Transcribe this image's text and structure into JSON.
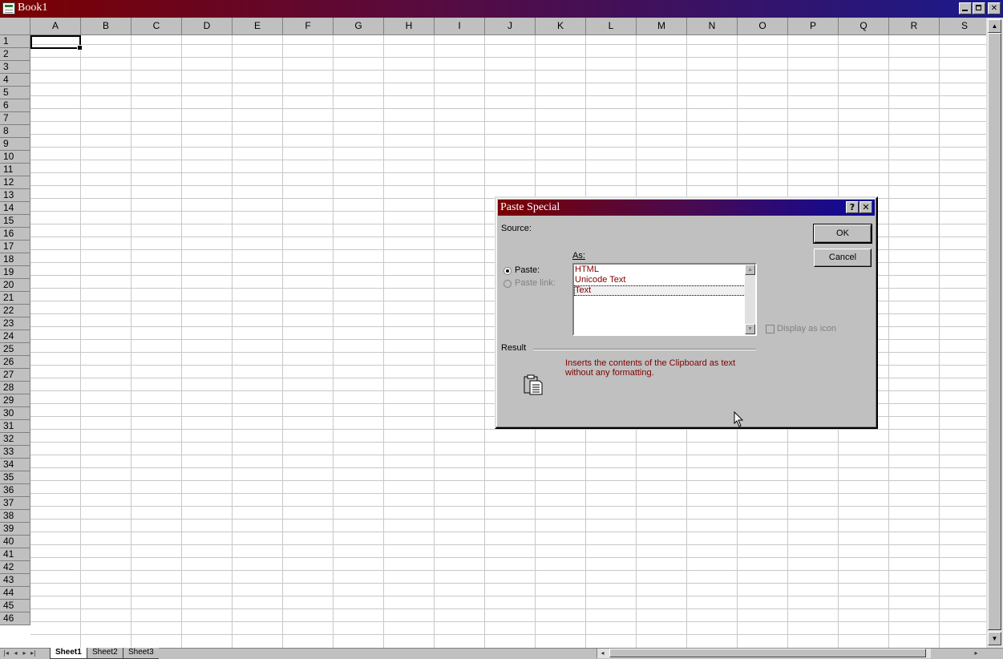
{
  "window": {
    "title": "Book1"
  },
  "grid": {
    "columns": [
      "A",
      "B",
      "C",
      "D",
      "E",
      "F",
      "G",
      "H",
      "I",
      "J",
      "K",
      "L",
      "M",
      "N",
      "O",
      "P",
      "Q",
      "R",
      "S"
    ],
    "rows": [
      "1",
      "2",
      "3",
      "4",
      "5",
      "6",
      "7",
      "8",
      "9",
      "10",
      "11",
      "12",
      "13",
      "14",
      "15",
      "16",
      "17",
      "18",
      "19",
      "20",
      "21",
      "22",
      "23",
      "24",
      "25",
      "26",
      "27",
      "28",
      "29",
      "30",
      "31",
      "32",
      "33",
      "34",
      "35",
      "36",
      "37",
      "38",
      "39",
      "40",
      "41",
      "42",
      "43",
      "44",
      "45",
      "46"
    ]
  },
  "sheets": [
    "Sheet1",
    "Sheet2",
    "Sheet3"
  ],
  "dialog": {
    "title": "Paste Special",
    "help_button": "?",
    "close_button": "✕",
    "source_label": "Source:",
    "as_label": "As:",
    "paste_label": "Paste:",
    "paste_link_label": "Paste link:",
    "list_items": [
      "HTML",
      "Unicode Text",
      "Text"
    ],
    "selected_item": "Text",
    "display_as_icon_label": "Display as icon",
    "result_label": "Result",
    "result_text_line1": "Inserts the contents of the Clipboard as text",
    "result_text_line2": "without any formatting.",
    "ok_label": "OK",
    "cancel_label": "Cancel"
  },
  "colors": {
    "title_start": "#7b0000",
    "title_end": "#1a1a8c",
    "label_maroon": "#800000"
  }
}
